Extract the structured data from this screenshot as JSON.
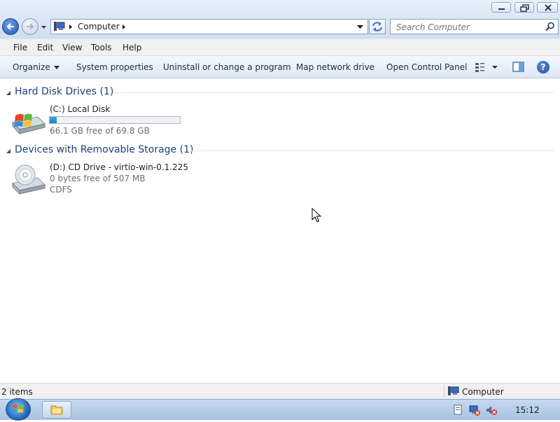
{
  "window": {
    "caption_buttons": {
      "minimize_icon": "minimize-icon",
      "maximize_icon": "restore-icon",
      "close_icon": "close-icon"
    }
  },
  "address_bar": {
    "location": "Computer",
    "search_placeholder": "Search Computer"
  },
  "menu": {
    "file": "File",
    "edit": "Edit",
    "view": "View",
    "tools": "Tools",
    "help": "Help"
  },
  "commands": {
    "organize": "Organize",
    "system_properties": "System properties",
    "uninstall": "Uninstall or change a program",
    "map_drive": "Map network drive",
    "control_panel": "Open Control Panel",
    "help": "?"
  },
  "groups": [
    {
      "title": "Hard Disk Drives (1)",
      "drives": [
        {
          "name": "(C:) Local Disk",
          "free_text": "66.1 GB free of 69.8 GB",
          "used_fraction": 0.053,
          "icon": "hard-disk-icon"
        }
      ]
    },
    {
      "title": "Devices with Removable Storage (1)",
      "drives": [
        {
          "name": "(D:) CD Drive - virtio-win-0.1.225",
          "free_text": "0 bytes free of 507 MB",
          "filesystem": "CDFS",
          "icon": "cd-drive-icon"
        }
      ]
    }
  ],
  "status": {
    "item_count": "2 items",
    "location_label": "Computer"
  },
  "taskbar": {
    "clock": "15:12"
  },
  "colors": {
    "group_title": "#1e3f7a",
    "usage_fill": "#1a84bf",
    "accent_blue": "#1f56b4"
  }
}
